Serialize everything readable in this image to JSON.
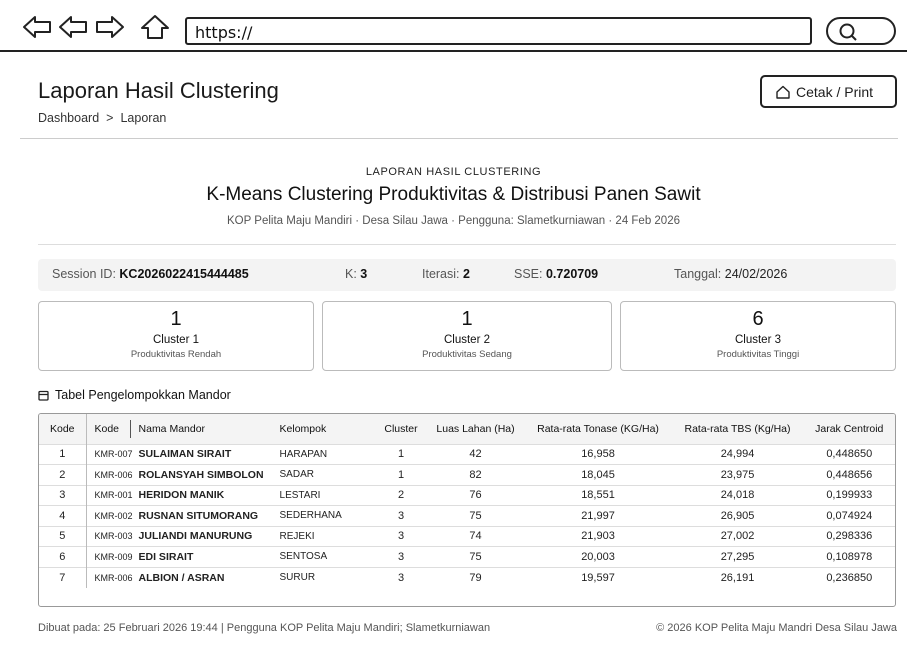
{
  "browser": {
    "url": "https://"
  },
  "header": {
    "title": "Laporan Hasil Clustering",
    "breadcrumb": [
      "Dashboard",
      ">",
      "Laporan"
    ],
    "print_label": "Cetak / Print"
  },
  "report": {
    "kicker": "LAPORAN HASIL CLUSTERING",
    "title": "K-Means Clustering Produktivitas & Distribusi Panen Sawit",
    "subtitle": "KOP Pelita Maju Mandiri  ·  Desa Silau Jawa  ·  Pengguna: Slametkurniawan · 24 Feb 2026"
  },
  "session": {
    "id_label": "Session ID:",
    "id_value": "KC2026022415444485",
    "k_label": "K:",
    "k_value": "3",
    "iter_label": "Iterasi:",
    "iter_value": "2",
    "sse_label": "SSE:",
    "sse_value": "0.720709",
    "date_label": "Tanggal:",
    "date_value": "24/02/2026"
  },
  "clusters": [
    {
      "count": "1",
      "name": "Cluster 1",
      "desc": "Produktivitas Rendah"
    },
    {
      "count": "1",
      "name": "Cluster 2",
      "desc": "Produktivitas Sedang"
    },
    {
      "count": "6",
      "name": "Cluster 3",
      "desc": "Produktivitas Tinggi"
    }
  ],
  "table": {
    "title": "Tabel Pengelompokkan Mandor",
    "headers": [
      "Kode",
      "Kode",
      "Nama Mandor",
      "Kelompok",
      "Cluster",
      "Luas Lahan (Ha)",
      "Rata-rata Tonase (KG/Ha)",
      "Rata-rata TBS (Kg/Ha)",
      "Jarak Centroid"
    ],
    "rows": [
      [
        "1",
        "KMR-007",
        "SULAIMAN SIRAIT",
        "HARAPAN",
        "1",
        "42",
        "16,958",
        "24,994",
        "0,448650"
      ],
      [
        "2",
        "KMR-006",
        "ROLANSYAH SIMBOLON",
        "SADAR",
        "1",
        "82",
        "18,045",
        "23,975",
        "0,448656"
      ],
      [
        "3",
        "KMR-001",
        "HERIDON MANIK",
        "LESTARI",
        "2",
        "76",
        "18,551",
        "24,018",
        "0,199933"
      ],
      [
        "4",
        "KMR-002",
        "RUSNAN SITUMORANG",
        "SEDERHANA",
        "3",
        "75",
        "21,997",
        "26,905",
        "0,074924"
      ],
      [
        "5",
        "KMR-003",
        "JULIANDI MANURUNG",
        "REJEKI",
        "3",
        "74",
        "21,903",
        "27,002",
        "0,298336"
      ],
      [
        "6",
        "KMR-009",
        "EDI SIRAIT",
        "SENTOSA",
        "3",
        "75",
        "20,003",
        "27,295",
        "0,108978"
      ],
      [
        "7",
        "KMR-006",
        "ALBION / ASRAN",
        "SURUR",
        "3",
        "79",
        "19,597",
        "26,191",
        "0,236850"
      ]
    ]
  },
  "footer": {
    "left": "Dibuat pada:  25 Februari 2026 19:44 | Pengguna KOP Pelita Maju Mandiri; Slametkurniawan",
    "right": "© 2026 KOP Pelita Maju Mandri  Desa Silau Jawa"
  }
}
